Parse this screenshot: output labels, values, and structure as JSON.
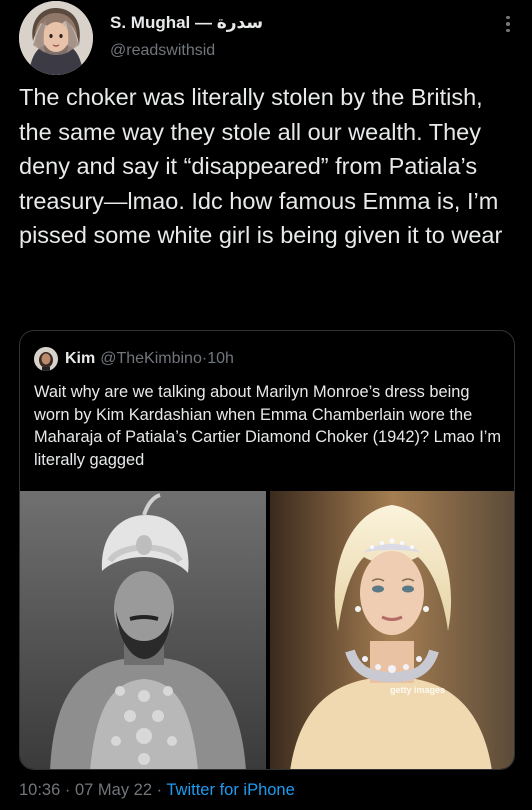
{
  "author": {
    "display_name": "S. Mughal — سدرة",
    "handle": "@readswithsid"
  },
  "tweet": {
    "text": "The choker was literally stolen by the British, the same way they stole all our wealth. They deny and say it “disappeared” from Patiala’s treasury—lmao. Idc how famous Emma is, I’m pissed some white girl is being given it to wear"
  },
  "quoted": {
    "name": "Kim",
    "handle": "@TheKimbino",
    "separator": " · ",
    "time": "10h",
    "text": "Wait why are we talking about Marilyn Monroe’s dress being worn by Kim Kardashian when Emma Chamberlain wore the Maharaja of Patiala’s Cartier Diamond Choker (1942)? Lmao I’m literally gagged",
    "watermark": "getty images"
  },
  "meta": {
    "time": "10:36",
    "sep1": " · ",
    "date": "07 May 22",
    "sep2": " · ",
    "source": "Twitter for iPhone"
  },
  "colors": {
    "background": "#000000",
    "text": "#e7e9ea",
    "secondary": "#71767b",
    "link": "#1d9bf0",
    "border": "#2f3336"
  },
  "icons": [
    "more-options-icon",
    "avatar-image",
    "quoted-avatar-image"
  ]
}
